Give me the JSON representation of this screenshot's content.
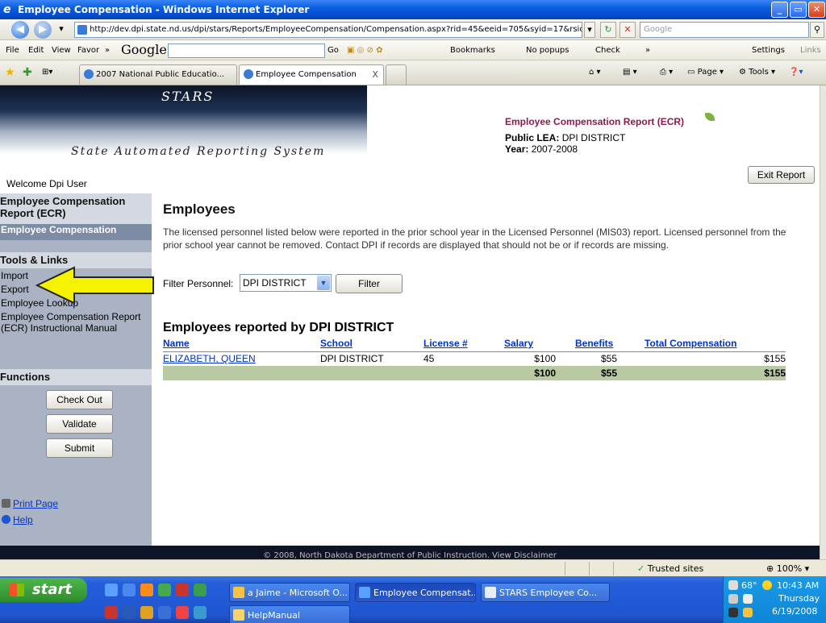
{
  "window": {
    "title": "Employee Compensation - Windows Internet Explorer",
    "controls": {
      "minimize": "_",
      "maximize": "▭",
      "close": "✕"
    }
  },
  "addressbar": {
    "url": "http://dev.dpi.state.nd.us/dpi/stars/Reports/EmployeeCompensation/Compensation.aspx?rid=45&eeid=705&syid=17&rsid=",
    "search_placeholder": "Google"
  },
  "menubar": {
    "items": [
      "File",
      "Edit",
      "View",
      "Favor",
      "»"
    ],
    "google_logo": "Google",
    "go": "Go",
    "bookmarks": "Bookmarks",
    "popups": "No popups",
    "check": "Check",
    "more": "»",
    "settings": "Settings",
    "links": "Links"
  },
  "tabs": {
    "items": [
      {
        "label": "2007 National Public Educatio..."
      },
      {
        "label": "Employee Compensation"
      }
    ],
    "close_symbol": "X",
    "page_cmd": "Page",
    "tools_cmd": "Tools"
  },
  "header": {
    "brand": "STARS",
    "system_name": "State Automated Reporting System",
    "welcome": "Welcome Dpi User",
    "report_title": "Employee Compensation Report (ECR)",
    "lea_label": "Public LEA:",
    "lea_value": "DPI DISTRICT",
    "year_label": "Year:",
    "year_value": "2007-2008",
    "exit_button": "Exit Report"
  },
  "sidebar": {
    "section1_title": "Employee Compensation Report (ECR)",
    "active_item": "Employee Compensation",
    "tools_title": "Tools & Links",
    "tools": [
      "Import",
      "Export",
      "Employee Lookup",
      "Employee Compensation Report (ECR) Instructional Manual"
    ],
    "functions_title": "Functions",
    "buttons": [
      "Check Out",
      "Validate",
      "Submit"
    ],
    "print": "Print Page",
    "help": "Help"
  },
  "main": {
    "heading": "Employees",
    "intro": "The licensed personnel listed below were reported in the prior school year in the Licensed Personnel (MIS03) report. Licensed personnel from the prior school year cannot be removed. Contact DPI if records are displayed that should not be or if records are missing.",
    "filter_label": "Filter Personnel:",
    "filter_value": "DPI DISTRICT",
    "filter_button": "Filter",
    "table_heading": "Employees reported by DPI DISTRICT",
    "columns": [
      "Name",
      "School",
      "License #",
      "Salary",
      "Benefits",
      "Total Compensation"
    ],
    "rows": [
      {
        "name": "ELIZABETH, QUEEN",
        "school": "DPI DISTRICT",
        "license": "45",
        "salary": "$100",
        "benefits": "$55",
        "total": "$155"
      }
    ],
    "totals": {
      "salary": "$100",
      "benefits": "$55",
      "total": "$155"
    }
  },
  "footer": {
    "text": "© 2008, North Dakota Department of Public Instruction. View Disclaimer"
  },
  "statusbar": {
    "zone": "Trusted sites",
    "zoom": "100%"
  },
  "taskbar": {
    "start": "start",
    "tasks": [
      "a Jaime - Microsoft O...",
      "Employee Compensat...",
      "STARS Employee Co...",
      "HelpManual"
    ],
    "temperature": "68°",
    "time": "10:43 AM",
    "day": "Thursday",
    "date": "6/19/2008"
  },
  "colors": {
    "sidebar_bg": "#a9b3c4",
    "active_nav": "#7e8ba4",
    "report_title": "#8b1a4a",
    "total_row": "#b9caa3",
    "link": "#0033cc",
    "arrow": "#f5f200"
  }
}
